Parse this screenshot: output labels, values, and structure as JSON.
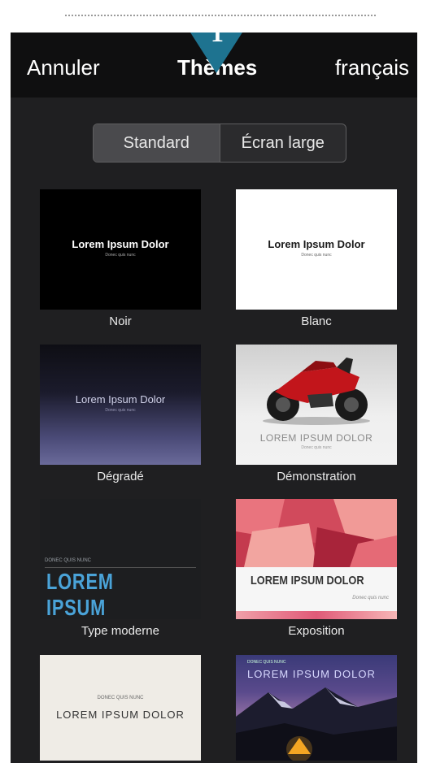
{
  "nav": {
    "cancel_label": "Annuler",
    "title": "Thèmes",
    "language_label": "français"
  },
  "callout": {
    "number": "1"
  },
  "segments": {
    "standard": "Standard",
    "widescreen": "Écran large",
    "selected": "Standard"
  },
  "themes": [
    {
      "name": "Noir",
      "title": "Lorem Ipsum Dolor",
      "subtitle": "Donec quis nunc"
    },
    {
      "name": "Blanc",
      "title": "Lorem Ipsum Dolor",
      "subtitle": "Donec quis nunc"
    },
    {
      "name": "Dégradé",
      "title": "Lorem Ipsum Dolor",
      "subtitle": "Donec quis nunc"
    },
    {
      "name": "Démonstration",
      "title": "LOREM IPSUM DOLOR",
      "subtitle": "Donec quis nunc"
    },
    {
      "name": "Type moderne",
      "title": "LOREM IPSUM",
      "subtitle": "DONEC QUIS NUNC"
    },
    {
      "name": "Exposition",
      "title": "LOREM IPSUM DOLOR",
      "subtitle": "Donec quis nunc"
    },
    {
      "name": "",
      "title": "LOREM IPSUM DOLOR",
      "subtitle": "DONEC QUIS NUNC"
    },
    {
      "name": "",
      "title": "LOREM IPSUM DOLOR",
      "subtitle": "DONEC QUIS NUNC"
    }
  ],
  "colors": {
    "callout": "#1e7390",
    "background": "#1f1f21",
    "navbar": "#0f0f10",
    "modern_accent": "#4aa3d8"
  }
}
